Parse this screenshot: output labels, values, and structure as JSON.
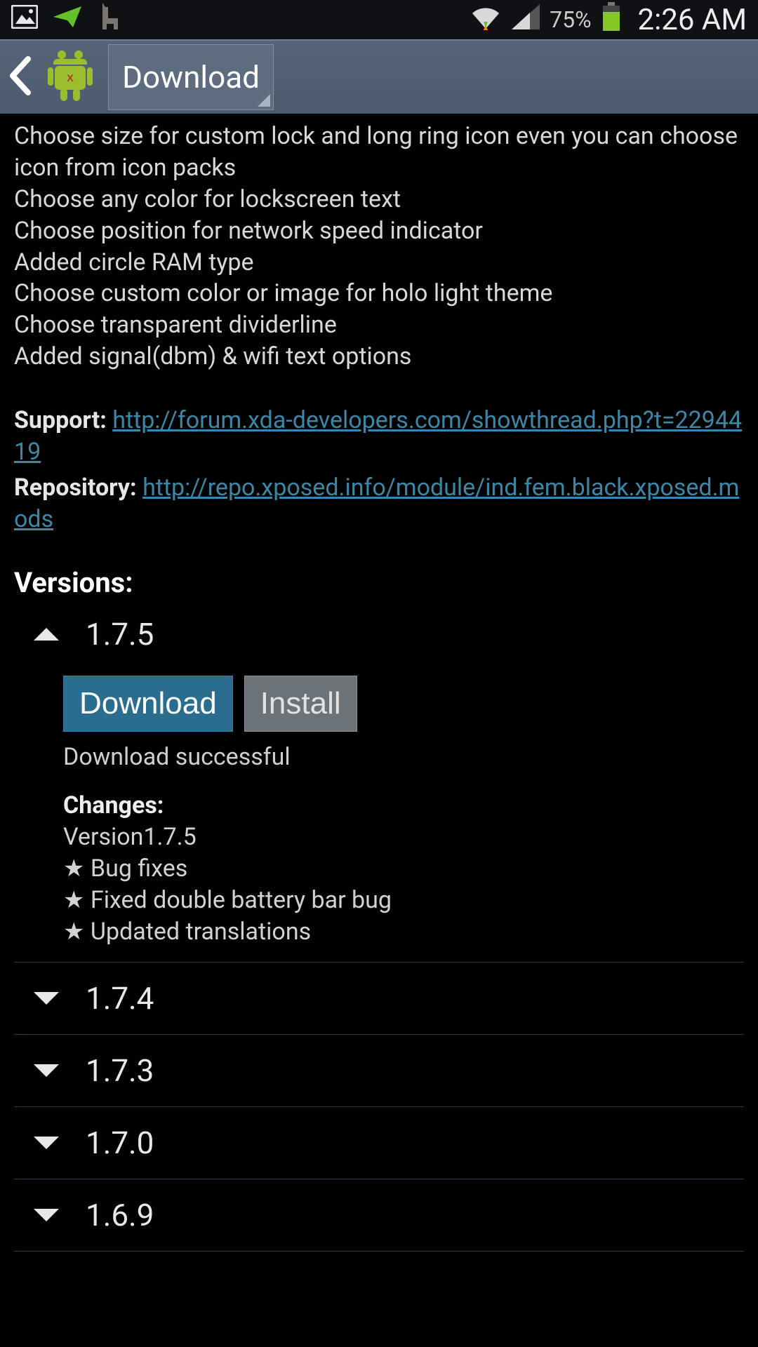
{
  "status_bar": {
    "battery_pct": "75%",
    "clock": "2:26 AM"
  },
  "action_bar": {
    "spinner_label": "Download"
  },
  "description_lines": [
    "Choose size for custom lock and long ring icon even you can choose icon from icon packs",
    "Choose any color for lockscreen text",
    "Choose position for network speed indicator",
    "Added circle RAM type",
    "Choose custom color or image for holo light theme",
    "Choose transparent dividerline",
    "Added signal(dbm) & wifi text options"
  ],
  "support": {
    "label": "Support: ",
    "url": "http://forum.xda-developers.com/showthread.php?t=2294419"
  },
  "repository": {
    "label": "Repository: ",
    "url": "http://repo.xposed.info/module/ind.fem.black.xposed.mods"
  },
  "versions_header": "Versions:",
  "expanded": {
    "name": "1.7.5",
    "download_label": "Download",
    "install_label": "Install",
    "status": "Download successful",
    "changes_title": "Changes:",
    "change_lines": [
      "Version1.7.5",
      "★ Bug fixes",
      "★ Fixed double battery bar bug",
      "★ Updated translations"
    ]
  },
  "collapsed_versions": [
    "1.7.4",
    "1.7.3",
    "1.7.0",
    "1.6.9"
  ]
}
